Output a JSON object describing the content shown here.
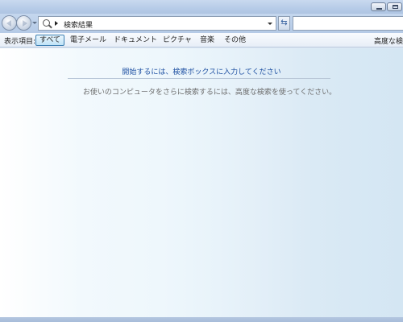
{
  "address_bar": {
    "location": "検索結果"
  },
  "filter_bar": {
    "label": "表示項目:",
    "filters": [
      "すべて",
      "電子メール",
      "ドキュメント",
      "ピクチャ",
      "音楽",
      "その他"
    ],
    "active_filter": "すべて",
    "advanced_search_label": "高度な検索"
  },
  "content": {
    "hint": "開始するには、検索ボックスに入力してください",
    "subhint": "お使いのコンピュータをさらに検索するには、高度な検索を使ってください。"
  },
  "icons": {
    "back": "back-arrow-icon",
    "forward": "forward-arrow-icon",
    "search": "search-icon",
    "refresh": "refresh-icon",
    "minimize": "minimize-icon",
    "restore": "restore-icon"
  },
  "colors": {
    "hint_text": "#1e50a2",
    "subhint_text": "#6d6d6d",
    "active_filter_border": "#3c7fb1"
  }
}
